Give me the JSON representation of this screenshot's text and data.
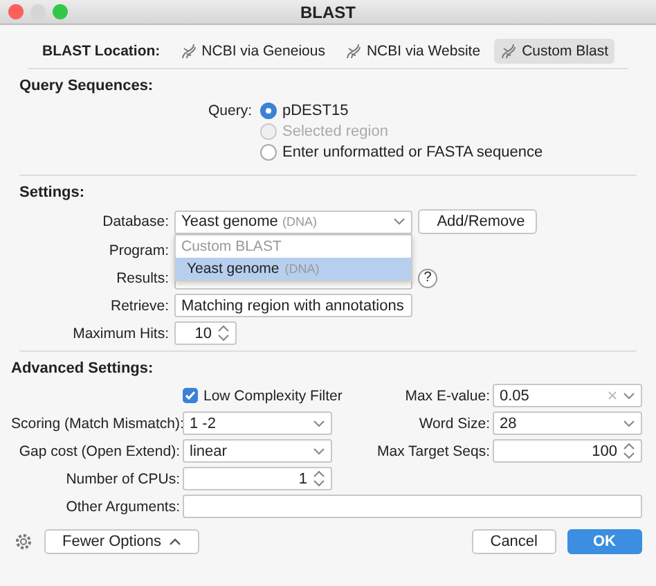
{
  "window": {
    "title": "BLAST"
  },
  "location": {
    "label": "BLAST Location:",
    "options": [
      {
        "label": "NCBI via Geneious",
        "selected": false
      },
      {
        "label": "NCBI via Website",
        "selected": false
      },
      {
        "label": "Custom Blast",
        "selected": true
      }
    ]
  },
  "query_sequences": {
    "heading": "Query Sequences:",
    "label": "Query:",
    "options": [
      {
        "label": "pDEST15",
        "selected": true,
        "disabled": false
      },
      {
        "label": "Selected region",
        "selected": false,
        "disabled": true
      },
      {
        "label": "Enter unformatted or FASTA sequence",
        "selected": false,
        "disabled": false
      }
    ]
  },
  "settings": {
    "heading": "Settings:",
    "database": {
      "label": "Database:",
      "value": "Yeast genome",
      "tag": "(DNA)"
    },
    "add_remove_button": "Add/Remove",
    "dropdown": [
      {
        "kind": "header",
        "label": "Custom BLAST"
      },
      {
        "kind": "option",
        "label": "Yeast genome",
        "tag": "(DNA)",
        "selected": true
      }
    ],
    "program": {
      "label": "Program:"
    },
    "results": {
      "label": "Results:",
      "help": "?"
    },
    "retrieve": {
      "label": "Retrieve:",
      "value": "Matching region with annotations"
    },
    "max_hits": {
      "label": "Maximum Hits:",
      "value": "10"
    }
  },
  "advanced": {
    "heading": "Advanced Settings:",
    "left": [
      {
        "kind": "checkbox",
        "label": "Low Complexity Filter",
        "checked": true
      },
      {
        "kind": "combo",
        "label": "Scoring (Match Mismatch):",
        "value": "1 -2"
      },
      {
        "kind": "combo",
        "label": "Gap cost (Open Extend):",
        "value": "linear"
      },
      {
        "kind": "spin",
        "label": "Number of CPUs:",
        "value": "1"
      }
    ],
    "right": [
      {
        "kind": "clearable",
        "label": "Max E-value:",
        "value": "0.05"
      },
      {
        "kind": "combo",
        "label": "Word Size:",
        "value": "28"
      },
      {
        "kind": "spin",
        "label": "Max Target Seqs:",
        "value": "100"
      }
    ],
    "other": {
      "label": "Other Arguments:"
    }
  },
  "footer": {
    "fewer_options": "Fewer Options",
    "cancel": "Cancel",
    "ok": "OK"
  }
}
